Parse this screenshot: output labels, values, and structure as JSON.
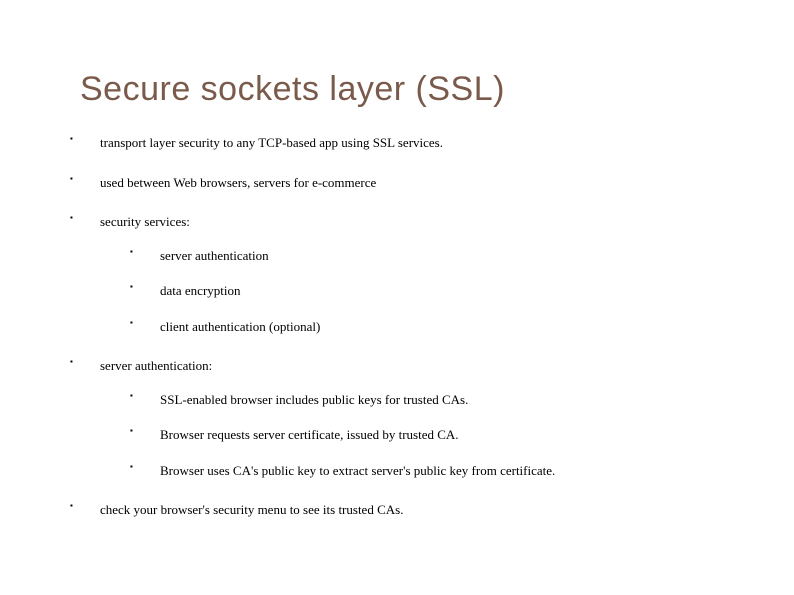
{
  "slide": {
    "title": "Secure sockets layer (SSL)",
    "bullets": {
      "b0": "transport layer security to any  TCP-based app using SSL services.",
      "b1": "used between Web browsers, servers for e-commerce",
      "b2": "security services:",
      "b2_sub": {
        "s0": "server authentication",
        "s1": "data encryption",
        "s2": "client authentication (optional)"
      },
      "b3": "server authentication:",
      "b3_sub": {
        "s0": "SSL-enabled browser includes public keys for trusted CAs.",
        "s1": "Browser requests server certificate, issued by trusted CA.",
        "s2": "Browser uses CA's public key to extract server's public key from certificate."
      },
      "b4": "check your browser's security menu to see its trusted CAs."
    }
  }
}
